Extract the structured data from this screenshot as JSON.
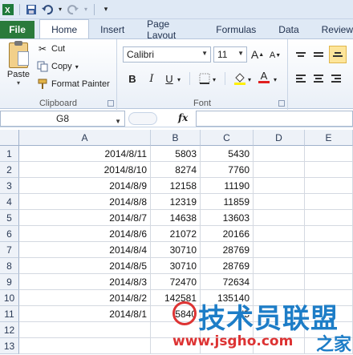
{
  "qat": {
    "icons": [
      "excel-icon",
      "save-icon",
      "undo-icon",
      "redo-icon",
      "customize-icon"
    ]
  },
  "tabs": [
    {
      "label": "File"
    },
    {
      "label": "Home"
    },
    {
      "label": "Insert"
    },
    {
      "label": "Page Layout"
    },
    {
      "label": "Formulas"
    },
    {
      "label": "Data"
    },
    {
      "label": "Review"
    }
  ],
  "clipboard": {
    "paste": "Paste",
    "cut": "Cut",
    "copy": "Copy",
    "format_painter": "Format Painter",
    "label": "Clipboard"
  },
  "font": {
    "name": "Calibri",
    "size": "11",
    "label": "Font",
    "bold": "B",
    "italic": "I",
    "underline": "U",
    "grow": "A",
    "shrink": "A",
    "color": "A"
  },
  "formula_bar": {
    "cell_ref": "G8",
    "fx": "fx",
    "value": ""
  },
  "sheet": {
    "columns": [
      "A",
      "B",
      "C",
      "D",
      "E"
    ],
    "rows": [
      {
        "num": "1",
        "a": "2014/8/11",
        "b": "5803",
        "c": "5430"
      },
      {
        "num": "2",
        "a": "2014/8/10",
        "b": "8274",
        "c": "7760"
      },
      {
        "num": "3",
        "a": "2014/8/9",
        "b": "12158",
        "c": "11190"
      },
      {
        "num": "4",
        "a": "2014/8/8",
        "b": "12319",
        "c": "11859"
      },
      {
        "num": "5",
        "a": "2014/8/7",
        "b": "14638",
        "c": "13603"
      },
      {
        "num": "6",
        "a": "2014/8/6",
        "b": "21072",
        "c": "20166"
      },
      {
        "num": "7",
        "a": "2014/8/4",
        "b": "30710",
        "c": "28769"
      },
      {
        "num": "8",
        "a": "2014/8/5",
        "b": "30710",
        "c": "28769"
      },
      {
        "num": "9",
        "a": "2014/8/3",
        "b": "72470",
        "c": "72634"
      },
      {
        "num": "10",
        "a": "2014/8/2",
        "b": "142581",
        "c": "135140"
      },
      {
        "num": "11",
        "a": "2014/8/1",
        "b": "5840",
        "c": "55"
      },
      {
        "num": "12",
        "a": "",
        "b": "",
        "c": ""
      },
      {
        "num": "13",
        "a": "",
        "b": "",
        "c": ""
      }
    ]
  },
  "watermark": {
    "title": "技术员联盟",
    "url": "www.jsgho.com",
    "home": "之家"
  }
}
